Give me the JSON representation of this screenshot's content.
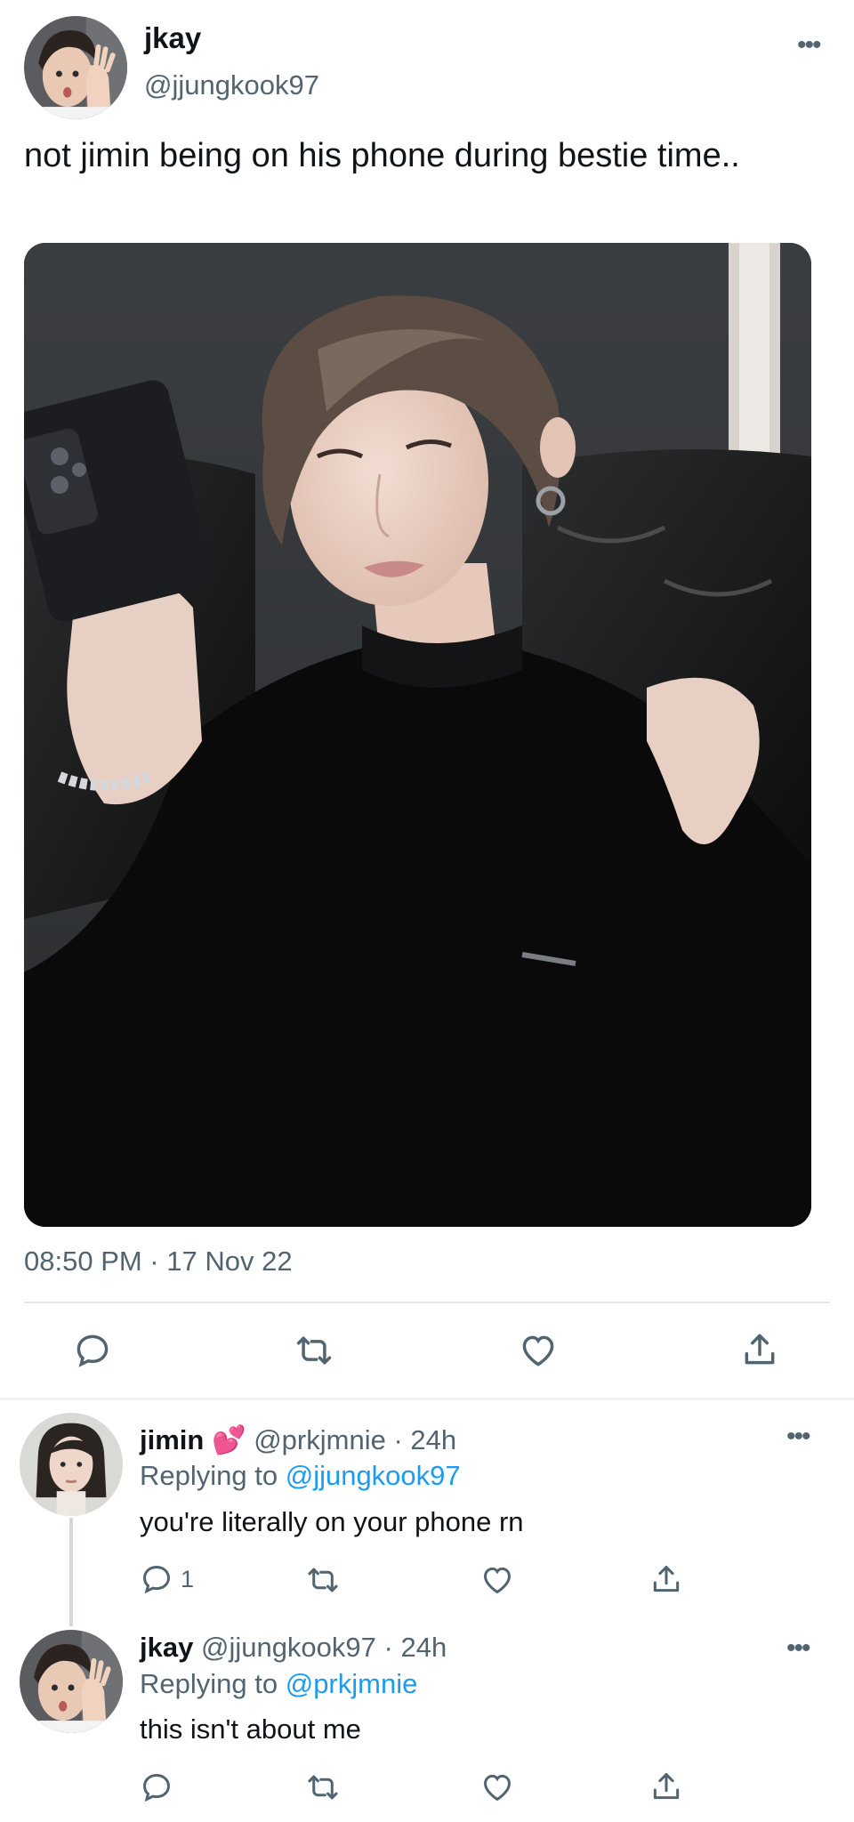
{
  "tweet": {
    "author_name": "jkay",
    "author_handle": "@jjungkook97",
    "text": "not jimin being on his phone during bestie time..",
    "timestamp": "08:50 PM · 17 Nov 22",
    "more_icon": "more-horizontal-icon",
    "actions": [
      {
        "icon": "reply-icon"
      },
      {
        "icon": "retweet-icon"
      },
      {
        "icon": "like-icon"
      },
      {
        "icon": "share-icon"
      }
    ]
  },
  "replies": [
    {
      "name": "jimin",
      "emoji": "💕",
      "handle": "@prkjmnie",
      "time": "· 24h",
      "replying_prefix": "Replying to",
      "replying_to": "@jjungkook97",
      "text": "you're literally on your phone rn",
      "reply_count": "1"
    },
    {
      "name": "jkay",
      "handle": "@jjungkook97",
      "time": "· 24h",
      "replying_prefix": "Replying to",
      "replying_to": "@prkjmnie",
      "text": "this isn't about me"
    }
  ],
  "colors": {
    "text_primary": "#0f1419",
    "text_secondary": "#536471",
    "mention": "#1d9bf0",
    "divider": "#e4e7ea"
  }
}
